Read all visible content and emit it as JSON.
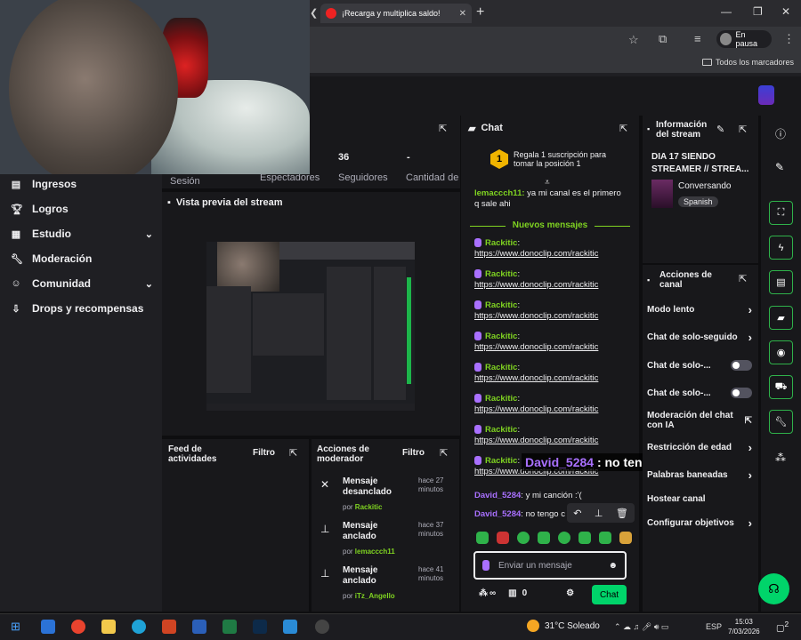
{
  "browser": {
    "tab_title": "¡Recarga y multiplica saldo!",
    "profile_label": "En pausa",
    "bookmarks_all": "Todos los marcadores"
  },
  "stats": {
    "session_label": "Sesión",
    "viewers_label": "Espectadores",
    "followers_value": "36",
    "followers_label": "Seguidores",
    "subs_value": "-",
    "subs_label": "Cantidad de suscripciones"
  },
  "nav": [
    {
      "label": "Ingresos",
      "icon": "money-icon"
    },
    {
      "label": "Logros",
      "icon": "trophy-icon"
    },
    {
      "label": "Estudio",
      "icon": "studio-icon",
      "chevron": true
    },
    {
      "label": "Moderación",
      "icon": "wrench-icon"
    },
    {
      "label": "Comunidad",
      "icon": "community-icon",
      "chevron": true
    },
    {
      "label": "Drops y recompensas",
      "icon": "drops-icon"
    }
  ],
  "preview": {
    "title": "Vista previa del stream"
  },
  "activity": {
    "title": "Feed de actividades",
    "filter": "Filtro"
  },
  "mod_actions": {
    "title": "Acciones de moderador",
    "filter": "Filtro",
    "items": [
      {
        "action": "Mensaje desanclado",
        "ago": "hace 27 minutos",
        "by_prefix": "por",
        "by": "Rackitic"
      },
      {
        "action": "Mensaje anclado",
        "ago": "hace 37 minutos",
        "by_prefix": "por",
        "by": "lemaccch11"
      },
      {
        "action": "Mensaje anclado",
        "ago": "hace 41 minutos",
        "by_prefix": "por",
        "by": "iTz_Angello"
      }
    ]
  },
  "chat": {
    "title": "Chat",
    "gift_badge": "1",
    "gift_text": "Regala 1 suscripción para tomar la posición 1",
    "pinned_user": "lemaccch11:",
    "pinned_text": "ya mi canal es el primero q sale ahi",
    "new_messages": "Nuevos mensajes",
    "messages": [
      {
        "user": "Rackitic",
        "sep": ":",
        "link": "https://www.donoclip.com/rackitic"
      },
      {
        "user": "Rackitic",
        "sep": ":",
        "link": "https://www.donoclip.com/rackitic"
      },
      {
        "user": "Rackitic",
        "sep": ":",
        "link": "https://www.donoclip.com/rackitic"
      },
      {
        "user": "Rackitic",
        "sep": ":",
        "link": "https://www.donoclip.com/rackitic"
      },
      {
        "user": "Rackitic",
        "sep": ":",
        "link": "https://www.donoclip.com/rackitic"
      },
      {
        "user": "Rackitic",
        "sep": ":",
        "link": "https://www.donoclip.com/rackitic"
      },
      {
        "user": "Rackitic",
        "sep": ":",
        "link": "https://www.donoclip.com/rackitic"
      },
      {
        "user": "Rackitic",
        "sep": ":",
        "link": "https://www.donoclip.com/rackitic"
      }
    ],
    "david1_user": "David_5284",
    "david1_text": ": y mi canción :'(",
    "david2_user": "David_5284",
    "david2_text": ": no tengo c",
    "overlay_user": "David_5284",
    "overlay_text": " : no tengo cholito",
    "input_placeholder": "Enviar un mensaje",
    "points_label": "∞",
    "store_count": "0",
    "send_label": "Chat"
  },
  "info": {
    "title": "Información del stream",
    "stream_title": "DIA 17 SIENDO STREAMER // STREA...",
    "category": "Conversando",
    "language": "Spanish"
  },
  "actions": {
    "title": "Acciones de canal",
    "items": [
      {
        "label": "Modo lento",
        "control": "chevron"
      },
      {
        "label": "Chat de solo-seguido",
        "control": "chevron"
      },
      {
        "label": "Chat de solo-...",
        "control": "toggle"
      },
      {
        "label": "Chat de solo-...",
        "control": "toggle"
      },
      {
        "label": "Moderación del chat con IA",
        "control": "external"
      },
      {
        "label": "Restricción de edad",
        "control": "chevron"
      },
      {
        "label": "Palabras baneadas",
        "control": "chevron"
      },
      {
        "label": "Hostear canal",
        "control": "none"
      },
      {
        "label": "Configurar objetivos",
        "control": "chevron"
      }
    ]
  },
  "taskbar": {
    "weather": "31°C Soleado",
    "lang": "ESP",
    "time": "15:03",
    "date": "7/03/2026",
    "notif": "2"
  }
}
